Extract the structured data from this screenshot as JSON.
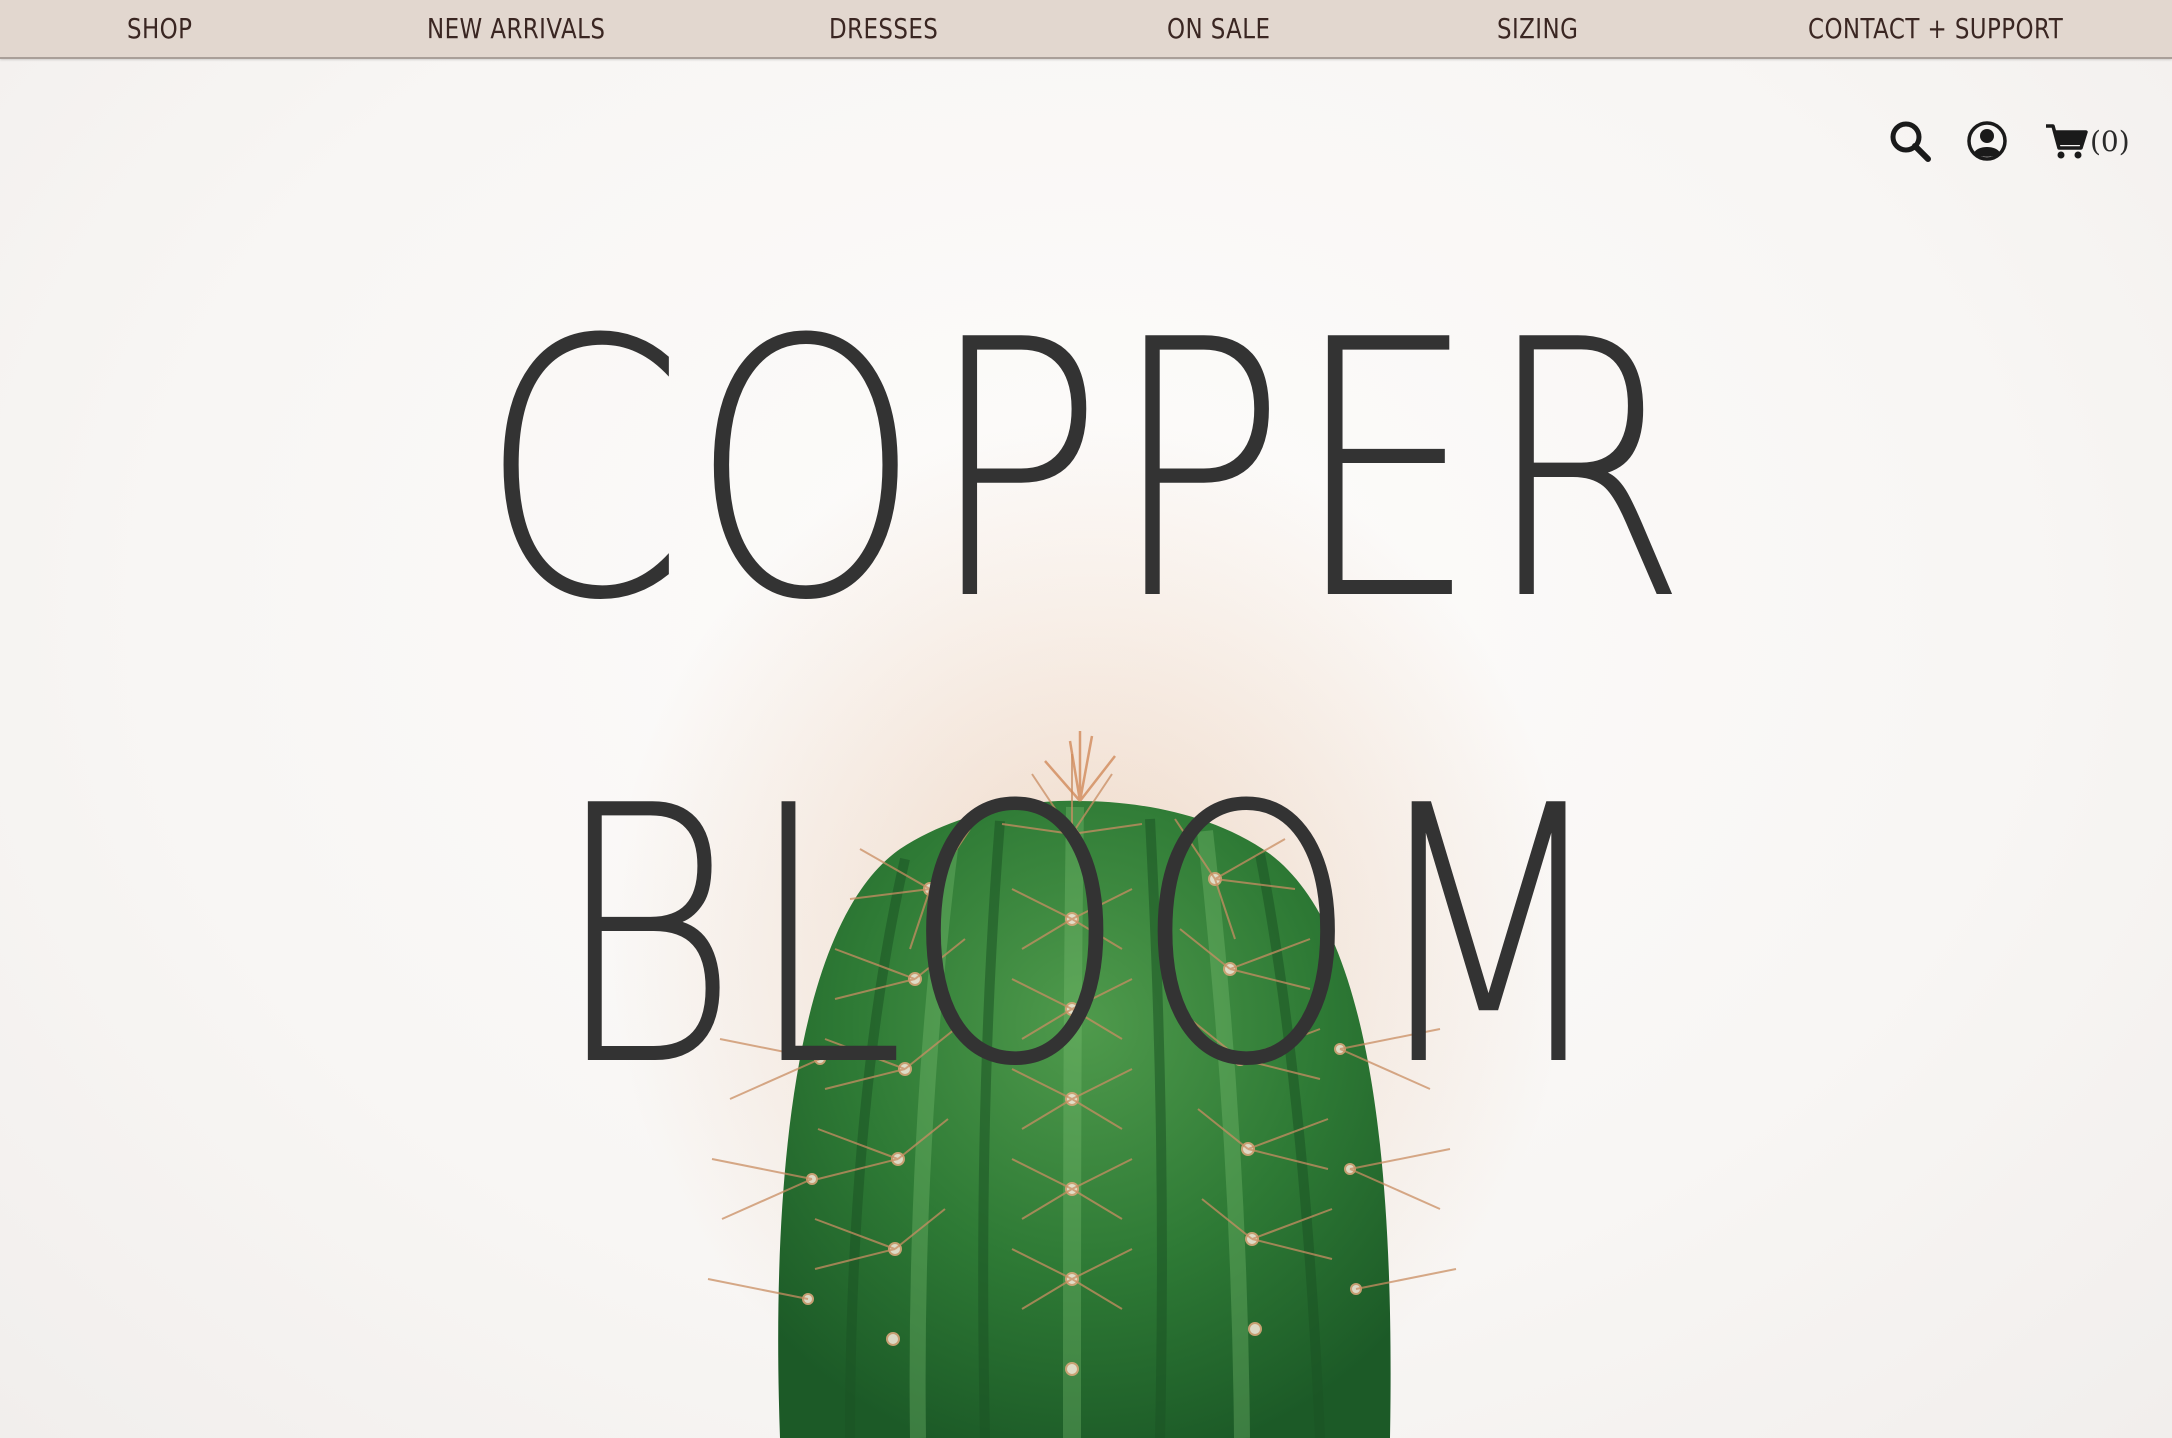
{
  "nav": {
    "items": [
      {
        "label": "SHOP"
      },
      {
        "label": "NEW ARRIVALS"
      },
      {
        "label": "DRESSES"
      },
      {
        "label": "ON SALE"
      },
      {
        "label": "SIZING"
      },
      {
        "label": "CONTACT + SUPPORT"
      }
    ]
  },
  "header_icons": {
    "search": "search-icon",
    "account": "account-icon",
    "cart": "cart-icon",
    "cart_count": "(0)"
  },
  "logo": {
    "line1": "COPPER",
    "line2": "BLOOM"
  },
  "colors": {
    "nav_bg": "#e2d7cf",
    "nav_text": "#3a2622",
    "logo_text": "#333333",
    "cactus_green": "#2f7a3a"
  }
}
